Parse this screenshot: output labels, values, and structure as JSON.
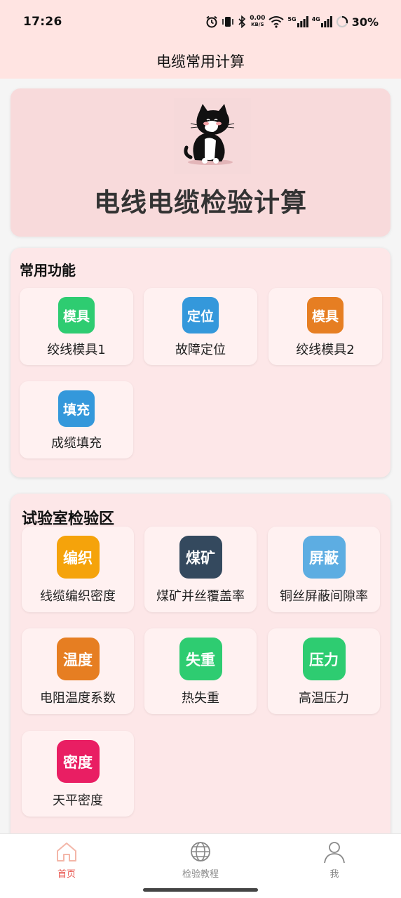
{
  "status_bar": {
    "time": "17:26",
    "speed_top": "0.00",
    "speed_bottom": "KB/S",
    "net1": "5G",
    "net2": "4G",
    "battery": "30%",
    "icons": [
      "alarm-icon",
      "vibrate-icon",
      "bluetooth-icon",
      "wifi-icon",
      "signal-icon",
      "signal-icon",
      "battery-ring-icon"
    ]
  },
  "header": {
    "title": "电缆常用计算"
  },
  "banner": {
    "title": "电线电缆检验计算",
    "image": "cat-illustration"
  },
  "common": {
    "title": "常用功能",
    "items": [
      {
        "badge": "模具",
        "label": "绞线模具1",
        "color": "#2ecc71"
      },
      {
        "badge": "定位",
        "label": "故障定位",
        "color": "#3498db"
      },
      {
        "badge": "模具",
        "label": "绞线模具2",
        "color": "#e67e22"
      },
      {
        "badge": "填充",
        "label": "成缆填充",
        "color": "#3498db"
      }
    ]
  },
  "lab": {
    "title": "试验室检验区",
    "items": [
      {
        "badge": "编织",
        "label": "线缆编织密度",
        "color": "#f5a30b"
      },
      {
        "badge": "煤矿",
        "label": "煤矿并丝覆盖率",
        "color": "#34495e"
      },
      {
        "badge": "屏蔽",
        "label": "铜丝屏蔽间隙率",
        "color": "#5dade2"
      },
      {
        "badge": "温度",
        "label": "电阻温度系数",
        "color": "#e67e22"
      },
      {
        "badge": "失重",
        "label": "热失重",
        "color": "#2ecc71"
      },
      {
        "badge": "压力",
        "label": "高温压力",
        "color": "#2ecc71"
      },
      {
        "badge": "密度",
        "label": "天平密度",
        "color": "#e91e63"
      }
    ]
  },
  "bottom_nav": {
    "items": [
      {
        "label": "首页",
        "icon": "home-icon",
        "active": true
      },
      {
        "label": "检验教程",
        "icon": "globe-icon",
        "active": false
      },
      {
        "label": "我",
        "icon": "person-icon",
        "active": false
      }
    ],
    "active_color": "#e8514a"
  }
}
